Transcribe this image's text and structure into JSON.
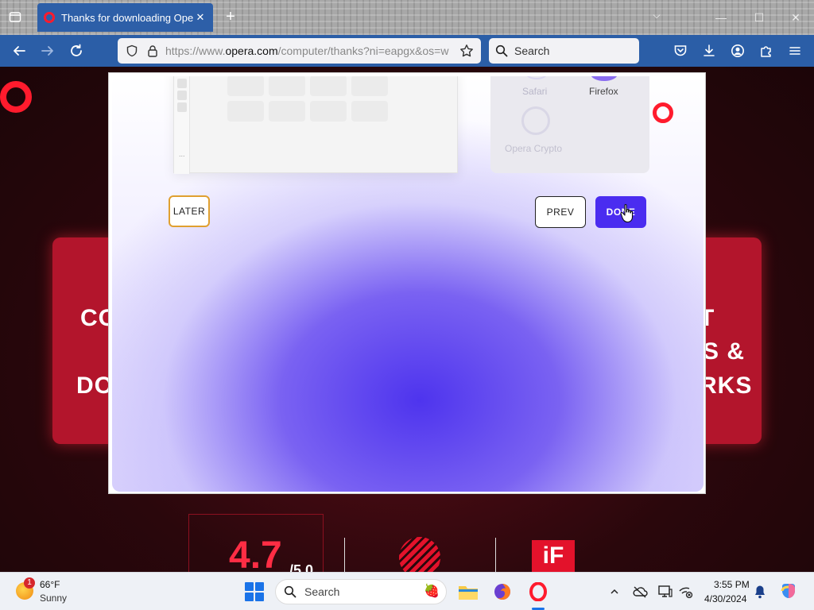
{
  "browser": {
    "tab_title": "Thanks for downloading Opera",
    "url_prefix": "https://www.",
    "url_domain": "opera.com",
    "url_rest": "/computer/thanks?ni=eapgx&os=w",
    "search_placeholder": "Search",
    "new_tab_symbol": "+",
    "close_symbol": "✕",
    "overflow_symbol": "⌵",
    "minimize_symbol": "—",
    "maximize_symbol": "☐",
    "window_close_symbol": "✕"
  },
  "page_background": {
    "left_lines": [
      "CO",
      "DO"
    ],
    "right_lines": [
      "T",
      "S &",
      "RKS"
    ],
    "rating": "4.7",
    "rating_suffix": "/5.0",
    "if_logo": "iF"
  },
  "modal": {
    "preview_dots": "...",
    "browsers": [
      "Safari",
      "Firefox",
      "Opera Crypto"
    ],
    "buttons": {
      "later": "LATER",
      "prev": "PREV",
      "done": "DONE"
    }
  },
  "taskbar": {
    "weather_badge": "1",
    "temperature": "66°F",
    "condition": "Sunny",
    "search_placeholder": "Search",
    "time": "3:55 PM",
    "date": "4/30/2024"
  },
  "colors": {
    "browser_accent": "#2b5ea7",
    "opera_red": "#ff1b2d",
    "done_button": "#4a2cf0"
  }
}
